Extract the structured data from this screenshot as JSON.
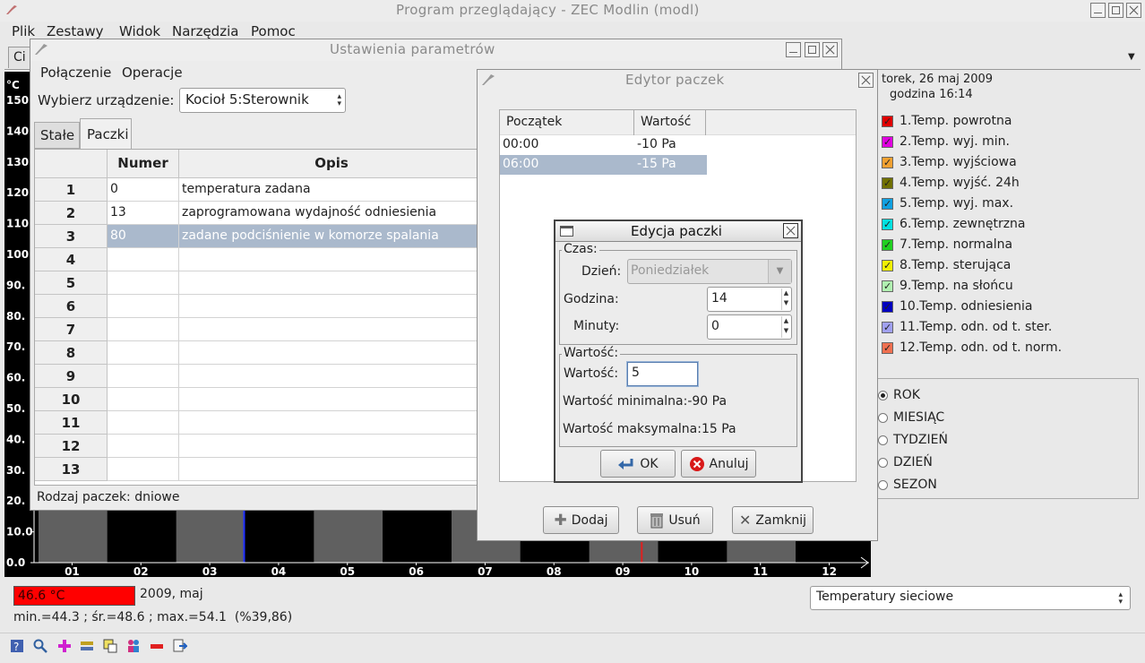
{
  "main_window": {
    "title": "Program przeglądający - ZEC Modlin (modl)",
    "menu": [
      "Plik",
      "Zestawy",
      "Widok",
      "Narzędzia",
      "Pomoc"
    ],
    "tab_partial": "Ci"
  },
  "right_panel": {
    "date": "torek, 26 maj 2009",
    "time": "godzina 16:14",
    "legend": [
      {
        "label": "1.Temp. powrotna",
        "color": "#e00000"
      },
      {
        "label": "2.Temp. wyj. min.",
        "color": "#e000e0"
      },
      {
        "label": "3.Temp. wyjściowa",
        "color": "#f0a030"
      },
      {
        "label": "4.Temp. wyjść. 24h",
        "color": "#707000"
      },
      {
        "label": "5.Temp. wyj. max.",
        "color": "#10a0e0"
      },
      {
        "label": "6.Temp. zewnętrzna",
        "color": "#00e0e0"
      },
      {
        "label": "7.Temp. normalna",
        "color": "#20d020"
      },
      {
        "label": "8.Temp. sterująca",
        "color": "#f0f000"
      },
      {
        "label": "9.Temp. na słońcu",
        "color": "#b0f0b0"
      },
      {
        "label": "10.Temp. odniesienia",
        "color": "#0000c0"
      },
      {
        "label": "11.Temp. odn. od t. ster.",
        "color": "#a0a0f0"
      },
      {
        "label": "12.Temp. odn. od t. norm.",
        "color": "#f07050"
      }
    ],
    "periods": [
      "ROK",
      "MIESIĄC",
      "TYDZIEŃ",
      "DZIEŃ",
      "SEZON"
    ],
    "selected_period": "ROK"
  },
  "chart": {
    "y_ticks": [
      "°C",
      "150.",
      "140.",
      "130.",
      "120.",
      "110.",
      "100.",
      "90.",
      "80.",
      "70.",
      "60.",
      "50.",
      "40.",
      "30.",
      "20.",
      "10.0",
      "0.0"
    ],
    "x_ticks": [
      "01",
      "02",
      "03",
      "04",
      "05",
      "06",
      "07",
      "08",
      "09",
      "10",
      "11",
      "12"
    ]
  },
  "status": {
    "current_temp": "46.6 °C",
    "period_label": "2009, maj",
    "stats": "min.=44.3 ; śr.=48.6 ; max.=54.1  (%39,86)",
    "series_select": "Temperatury sieciowe"
  },
  "params_window": {
    "title": "Ustawienia parametrów",
    "menu": [
      "Połączenie",
      "Operacje"
    ],
    "device_label": "Wybierz urządzenie:",
    "device_value": "Kocioł 5:Sterownik",
    "tabs": [
      "Stałe",
      "Paczki"
    ],
    "active_tab": "Paczki",
    "columns": [
      "Numer",
      "Opis"
    ],
    "rows": [
      {
        "n": "1",
        "numer": "0",
        "opis": "temperatura zadana"
      },
      {
        "n": "2",
        "numer": "13",
        "opis": "zaprogramowana wydajność odniesienia"
      },
      {
        "n": "3",
        "numer": "80",
        "opis": "zadane podciśnienie w komorze spalania"
      },
      {
        "n": "4",
        "numer": "",
        "opis": ""
      },
      {
        "n": "5",
        "numer": "",
        "opis": ""
      },
      {
        "n": "6",
        "numer": "",
        "opis": ""
      },
      {
        "n": "7",
        "numer": "",
        "opis": ""
      },
      {
        "n": "8",
        "numer": "",
        "opis": ""
      },
      {
        "n": "9",
        "numer": "",
        "opis": ""
      },
      {
        "n": "10",
        "numer": "",
        "opis": ""
      },
      {
        "n": "11",
        "numer": "",
        "opis": ""
      },
      {
        "n": "12",
        "numer": "",
        "opis": ""
      },
      {
        "n": "13",
        "numer": "",
        "opis": ""
      }
    ],
    "footer": "Rodzaj paczek: dniowe"
  },
  "editor_window": {
    "title": "Edytor paczek",
    "columns": [
      "Początek",
      "Wartość"
    ],
    "rows": [
      {
        "start": "00:00",
        "value": "-10 Pa"
      },
      {
        "start": "06:00",
        "value": "-15 Pa"
      }
    ],
    "add": "Dodaj",
    "remove": "Usuń",
    "close": "Zamknij"
  },
  "edit_dialog": {
    "title": "Edycja paczki",
    "time_group": "Czas:",
    "day_label": "Dzień:",
    "day_value": "Poniedziałek",
    "hour_label": "Godzina:",
    "hour_value": "14",
    "minute_label": "Minuty:",
    "minute_value": "0",
    "value_group": "Wartość:",
    "value_label": "Wartość:",
    "value_input": "5",
    "min_text": "Wartość minimalna:-90 Pa",
    "max_text": "Wartość maksymalna:15 Pa",
    "ok": "OK",
    "cancel": "Anuluj"
  }
}
